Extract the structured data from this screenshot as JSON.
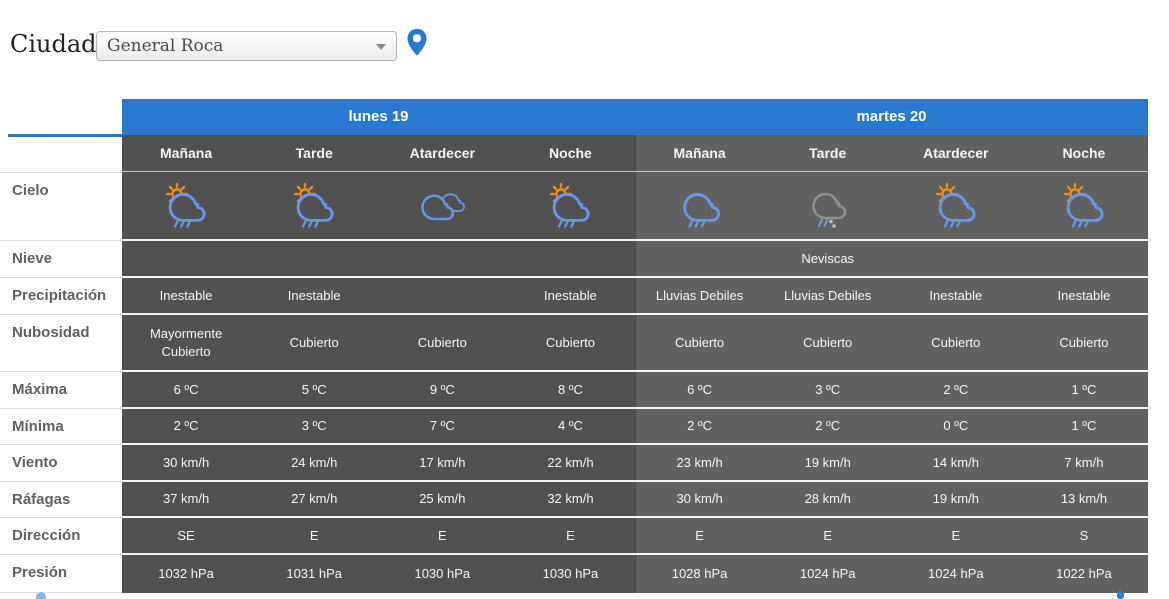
{
  "header": {
    "city_label": "Ciudad:",
    "city_selected": "General Roca"
  },
  "table": {
    "days": [
      {
        "label": "lunes 19"
      },
      {
        "label": "martes 20"
      }
    ],
    "periods": [
      "Mañana",
      "Tarde",
      "Atardecer",
      "Noche",
      "Mañana",
      "Tarde",
      "Atardecer",
      "Noche"
    ],
    "row_labels": [
      "Cielo",
      "Nieve",
      "Precipitación",
      "Nubosidad",
      "Máxima",
      "Mínima",
      "Viento",
      "Ráfagas",
      "Dirección",
      "Presión"
    ],
    "cielo_icons": [
      "sun-cloud-rain",
      "sun-cloud-rain",
      "clouds",
      "sun-cloud-rain",
      "cloud-rain",
      "cloud-sleet",
      "sun-cloud-rain",
      "sun-cloud-rain"
    ],
    "nieve": [
      "",
      "",
      "",
      "",
      "",
      "Neviscas",
      "",
      ""
    ],
    "precipitacion": [
      "Inestable",
      "Inestable",
      "",
      "Inestable",
      "Lluvias Debiles",
      "Lluvias Debiles",
      "Inestable",
      "Inestable"
    ],
    "nubosidad": [
      "Mayormente Cubierto",
      "Cubierto",
      "Cubierto",
      "Cubierto",
      "Cubierto",
      "Cubierto",
      "Cubierto",
      "Cubierto"
    ],
    "maxima": [
      "6 ºC",
      "5 ºC",
      "9 ºC",
      "8 ºC",
      "6 ºC",
      "3 ºC",
      "2 ºC",
      "1 ºC"
    ],
    "minima": [
      "2 ºC",
      "3 ºC",
      "7 ºC",
      "4 ºC",
      "2 ºC",
      "2 ºC",
      "0 ºC",
      "1 ºC"
    ],
    "viento": [
      "30 km/h",
      "24 km/h",
      "17 km/h",
      "22 km/h",
      "23 km/h",
      "19 km/h",
      "14 km/h",
      "7 km/h"
    ],
    "rafagas": [
      "37 km/h",
      "27 km/h",
      "25 km/h",
      "32 km/h",
      "30 km/h",
      "28 km/h",
      "19 km/h",
      "13 km/h"
    ],
    "direccion": [
      "SE",
      "E",
      "E",
      "E",
      "E",
      "E",
      "E",
      "S"
    ],
    "presion": [
      "1032 hPa",
      "1031 hPa",
      "1030 hPa",
      "1030 hPa",
      "1028 hPa",
      "1024 hPa",
      "1024 hPa",
      "1022 hPa"
    ]
  },
  "colors": {
    "header_blue": "#2878cf",
    "day1_bg": "#515151",
    "day2_bg": "#616161",
    "icon_blue": "#6a96ea",
    "icon_orange": "#f28d15",
    "icon_gray": "#909090"
  }
}
